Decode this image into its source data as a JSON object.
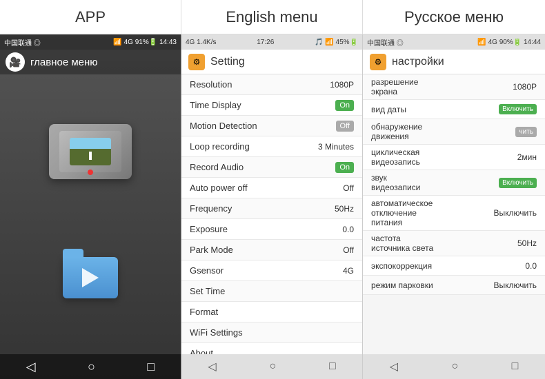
{
  "header": {
    "app_label": "APP",
    "english_label": "English menu",
    "russian_label": "Русское меню"
  },
  "app_panel": {
    "status_left": "中国联通 ◎",
    "status_right": "📶 4G↑↓ 91% 🔋 14:43",
    "title": "главное меню",
    "bottom_nav": [
      "◁",
      "○",
      "□"
    ]
  },
  "english_settings": {
    "status_left": "4G 1.4K/s",
    "status_center": "17:26",
    "status_right": "🎵 📶 45% 🔋",
    "title": "Setting",
    "rows": [
      {
        "label": "Resolution",
        "value": "1080P",
        "type": "text"
      },
      {
        "label": "Time Display",
        "value": "On",
        "type": "toggle_on"
      },
      {
        "label": "Motion Detection",
        "value": "Off",
        "type": "toggle_off"
      },
      {
        "label": "Loop recording",
        "value": "3 Minutes",
        "type": "text"
      },
      {
        "label": "Record Audio",
        "value": "On",
        "type": "toggle_on"
      },
      {
        "label": "Auto power off",
        "value": "Off",
        "type": "text"
      },
      {
        "label": "Frequency",
        "value": "50Hz",
        "type": "text"
      },
      {
        "label": "Exposure",
        "value": "0.0",
        "type": "text"
      },
      {
        "label": "Park Mode",
        "value": "Off",
        "type": "text"
      },
      {
        "label": "Gsensor",
        "value": "4G",
        "type": "text"
      },
      {
        "label": "Set Time",
        "value": "",
        "type": "text"
      },
      {
        "label": "Format",
        "value": "",
        "type": "text"
      },
      {
        "label": "WiFi Settings",
        "value": "",
        "type": "text"
      },
      {
        "label": "About",
        "value": "",
        "type": "text"
      }
    ],
    "bottom_nav": [
      "◁",
      "○",
      "□"
    ]
  },
  "russian_settings": {
    "status_left": "中国联通 ◎",
    "status_right": "📶 4G↑↓ 90% 🔋 14:44",
    "title": "настройки",
    "rows": [
      {
        "label": "разрешение\nэкрана",
        "value": "1080P",
        "type": "text"
      },
      {
        "label": "вид даты",
        "value": "Включить",
        "type": "btn_on"
      },
      {
        "label": "обнаружение\nдвижения",
        "value": "чить",
        "type": "btn_off"
      },
      {
        "label": "циклическая\nвидеозапись",
        "value": "2мин",
        "type": "text"
      },
      {
        "label": "звук\nвидеозаписи",
        "value": "Включить",
        "type": "btn_on"
      },
      {
        "label": "автоматическое\nотключение\nпитания",
        "value": "Выключить",
        "type": "text"
      },
      {
        "label": "частота\nисточника света",
        "value": "50Hz",
        "type": "text"
      },
      {
        "label": "экспокоррекция",
        "value": "0.0",
        "type": "text"
      },
      {
        "label": "режим парковки",
        "value": "Выключить",
        "type": "text"
      }
    ],
    "bottom_nav": [
      "◁",
      "○",
      "□"
    ]
  }
}
